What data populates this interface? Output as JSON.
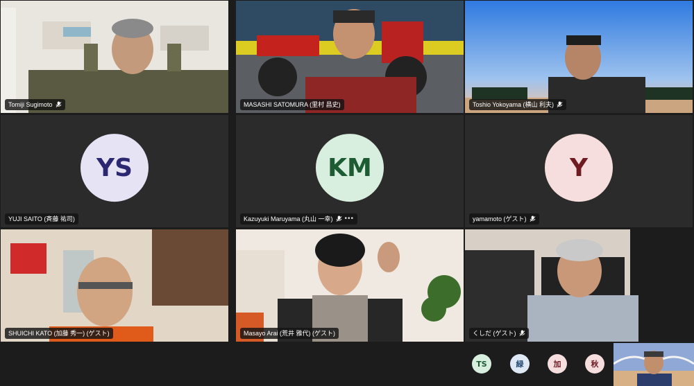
{
  "participants": [
    {
      "name": "Tomiji Sugimoto",
      "has_video": true
    },
    {
      "name": "MASASHI SATOMURA (里村 昌史)",
      "has_video": true
    },
    {
      "name": "Toshio Yokoyama (横山 利夫)",
      "has_video": true
    },
    {
      "name": "YUJI SAITO (斉藤 祐司)",
      "initials": "YS",
      "avatar_bg": "#e6e3f5",
      "avatar_fg": "#2b2770"
    },
    {
      "name": "Kazuyuki Maruyama (丸山 一幸)",
      "initials": "KM",
      "avatar_bg": "#d8efdf",
      "avatar_fg": "#1d5b33"
    },
    {
      "name": "yamamoto (ゲスト)",
      "initials": "Y",
      "avatar_bg": "#f6dede",
      "avatar_fg": "#6e1c22"
    },
    {
      "name": "SHUICHI KATO (加藤 秀一) (ゲスト)",
      "has_video": true
    },
    {
      "name": "Masayo Arai (荒井 雅代) (ゲスト)",
      "has_video": true
    },
    {
      "name": "くしだ (ゲスト)",
      "has_video": true
    }
  ],
  "more_options": "•••",
  "overflow_participants": [
    {
      "initials": "TS",
      "bg": "#d8efdf",
      "fg": "#1d5b33"
    },
    {
      "initials": "緑",
      "bg": "#dfe9f5",
      "fg": "#234a73"
    },
    {
      "initials": "加",
      "bg": "#f6dede",
      "fg": "#6e1c22"
    },
    {
      "initials": "秋",
      "bg": "#f6dede",
      "fg": "#6e1c22"
    }
  ]
}
